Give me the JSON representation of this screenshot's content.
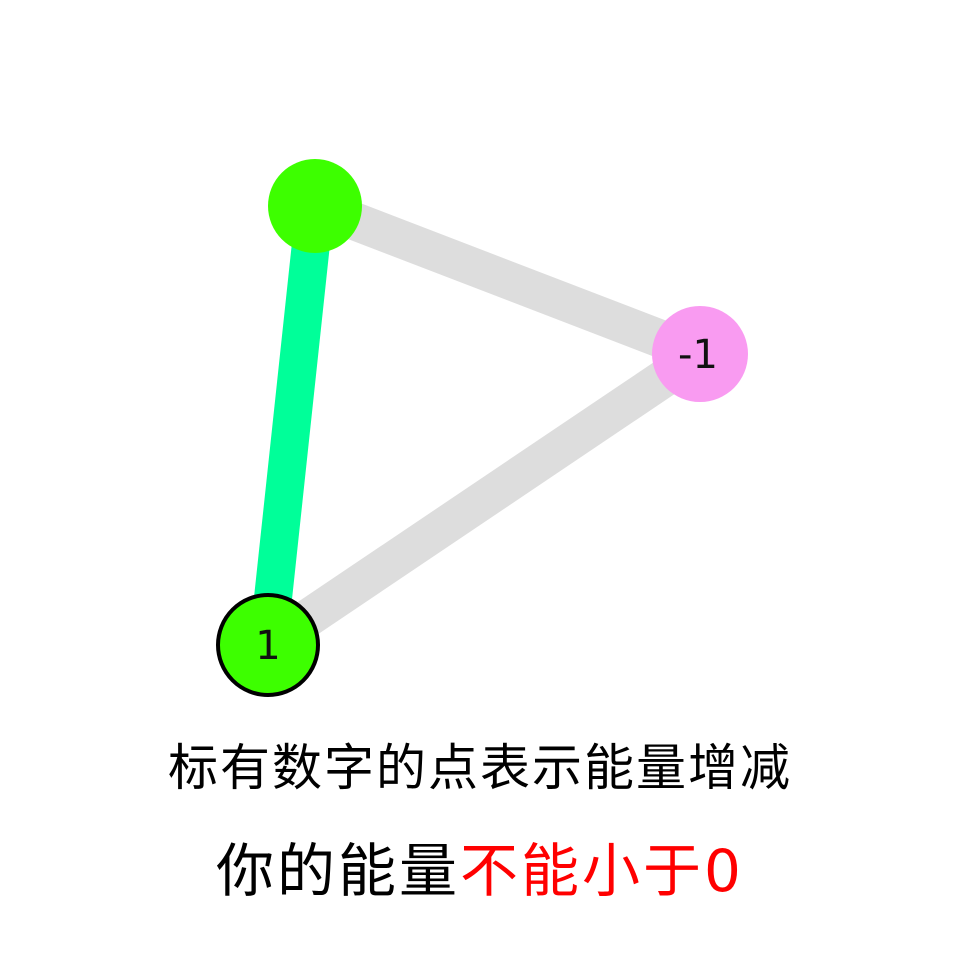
{
  "game": {
    "nodes": [
      {
        "id": "top",
        "label": "",
        "color": "#3dff00",
        "selected": false
      },
      {
        "id": "right",
        "label": "-1",
        "color": "#f99bf1",
        "selected": false
      },
      {
        "id": "bottom",
        "label": "1",
        "color": "#3dff00",
        "selected": true
      }
    ],
    "edges": [
      {
        "from": "top",
        "to": "right",
        "color": "#dddddd",
        "traversed": false
      },
      {
        "from": "right",
        "to": "bottom",
        "color": "#dddddd",
        "traversed": false
      },
      {
        "from": "top",
        "to": "bottom",
        "color": "#00ff99",
        "traversed": true
      }
    ]
  },
  "instructions": {
    "line1": "标有数字的点表示能量增减",
    "line2_normal": "你的能量",
    "line2_highlight": "不能小于0",
    "highlight_color": "#ff0000"
  }
}
